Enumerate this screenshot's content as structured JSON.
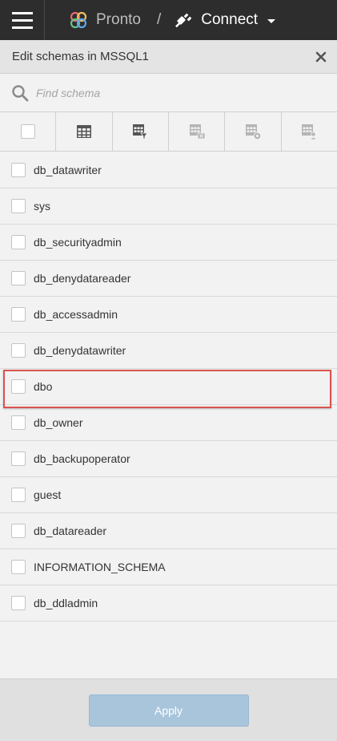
{
  "topbar": {
    "brand": "Pronto",
    "separator": "/",
    "connect_label": "Connect"
  },
  "panel": {
    "title": "Edit schemas in MSSQL1"
  },
  "search": {
    "placeholder": "Find schema"
  },
  "toolbar": {
    "icons": [
      "select-all-checkbox",
      "table-icon",
      "table-filter-icon",
      "table-delete-icon",
      "table-settings-icon",
      "table-user-icon"
    ]
  },
  "schemas": [
    {
      "name": "db_datawriter",
      "checked": false
    },
    {
      "name": "sys",
      "checked": false
    },
    {
      "name": "db_securityadmin",
      "checked": false
    },
    {
      "name": "db_denydatareader",
      "checked": false
    },
    {
      "name": "db_accessadmin",
      "checked": false
    },
    {
      "name": "db_denydatawriter",
      "checked": false
    },
    {
      "name": "dbo",
      "checked": false
    },
    {
      "name": "db_owner",
      "checked": false
    },
    {
      "name": "db_backupoperator",
      "checked": false
    },
    {
      "name": "guest",
      "checked": false
    },
    {
      "name": "db_datareader",
      "checked": false
    },
    {
      "name": "INFORMATION_SCHEMA",
      "checked": false
    },
    {
      "name": "db_ddladmin",
      "checked": false
    }
  ],
  "footer": {
    "apply_label": "Apply"
  },
  "colors": {
    "topbar": "#2d2d2d",
    "highlight": "#d9534f",
    "apply_disabled": "#a9c5dc"
  }
}
